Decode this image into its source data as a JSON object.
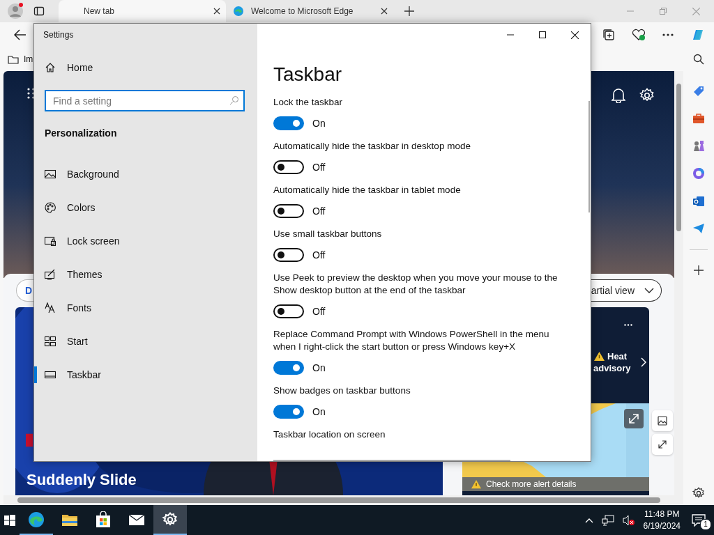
{
  "browser": {
    "tabs": [
      {
        "label": "New tab",
        "selected": true
      },
      {
        "label": "Welcome to Microsoft Edge",
        "selected": false
      }
    ],
    "favorites": [
      {
        "label": "Im"
      }
    ]
  },
  "page": {
    "filter_pill": "D",
    "view_button": "artial view",
    "headline": [
      "Suddenly Slide"
    ],
    "weather": {
      "alert": "Heat advisory",
      "details": "Check more alert details"
    }
  },
  "settings": {
    "title": "Settings",
    "home": "Home",
    "search": {
      "placeholder": "Find a setting"
    },
    "section": "Personalization",
    "nav": [
      {
        "label": "Background",
        "kind": "background",
        "selected": false
      },
      {
        "label": "Colors",
        "kind": "colors",
        "selected": false
      },
      {
        "label": "Lock screen",
        "kind": "lock",
        "selected": false
      },
      {
        "label": "Themes",
        "kind": "themes",
        "selected": false
      },
      {
        "label": "Fonts",
        "kind": "fonts",
        "selected": false
      },
      {
        "label": "Start",
        "kind": "start",
        "selected": false
      },
      {
        "label": "Taskbar",
        "kind": "taskbar",
        "selected": true
      }
    ],
    "heading": "Taskbar",
    "options": [
      {
        "kind": "toggle",
        "label": "Lock the taskbar",
        "on": true,
        "state_text": "On"
      },
      {
        "kind": "toggle",
        "label": "Automatically hide the taskbar in desktop mode",
        "on": false,
        "state_text": "Off"
      },
      {
        "kind": "toggle",
        "label": "Automatically hide the taskbar in tablet mode",
        "on": false,
        "state_text": "Off"
      },
      {
        "kind": "toggle",
        "label": "Use small taskbar buttons",
        "on": false,
        "state_text": "Off"
      },
      {
        "kind": "toggle",
        "label": "Use Peek to preview the desktop when you move your mouse to the Show desktop button at the end of the taskbar",
        "on": false,
        "state_text": "Off"
      },
      {
        "kind": "toggle",
        "label": "Replace Command Prompt with Windows PowerShell in the menu when I right-click the start button or press Windows key+X",
        "on": true,
        "state_text": "On"
      },
      {
        "kind": "toggle",
        "label": "Show badges on taskbar buttons",
        "on": true,
        "state_text": "On"
      },
      {
        "kind": "heading",
        "label": "Taskbar location on screen"
      }
    ]
  },
  "taskbar": {
    "apps": [
      {
        "kind": "edge",
        "running": true,
        "selected": false
      },
      {
        "kind": "explorer",
        "running": false,
        "selected": false
      },
      {
        "kind": "store",
        "running": false,
        "selected": false
      },
      {
        "kind": "mail",
        "running": false,
        "selected": false
      },
      {
        "kind": "settings",
        "running": true,
        "selected": true
      }
    ],
    "time": "11:48 PM",
    "date": "6/19/2024",
    "notifications": "1"
  }
}
